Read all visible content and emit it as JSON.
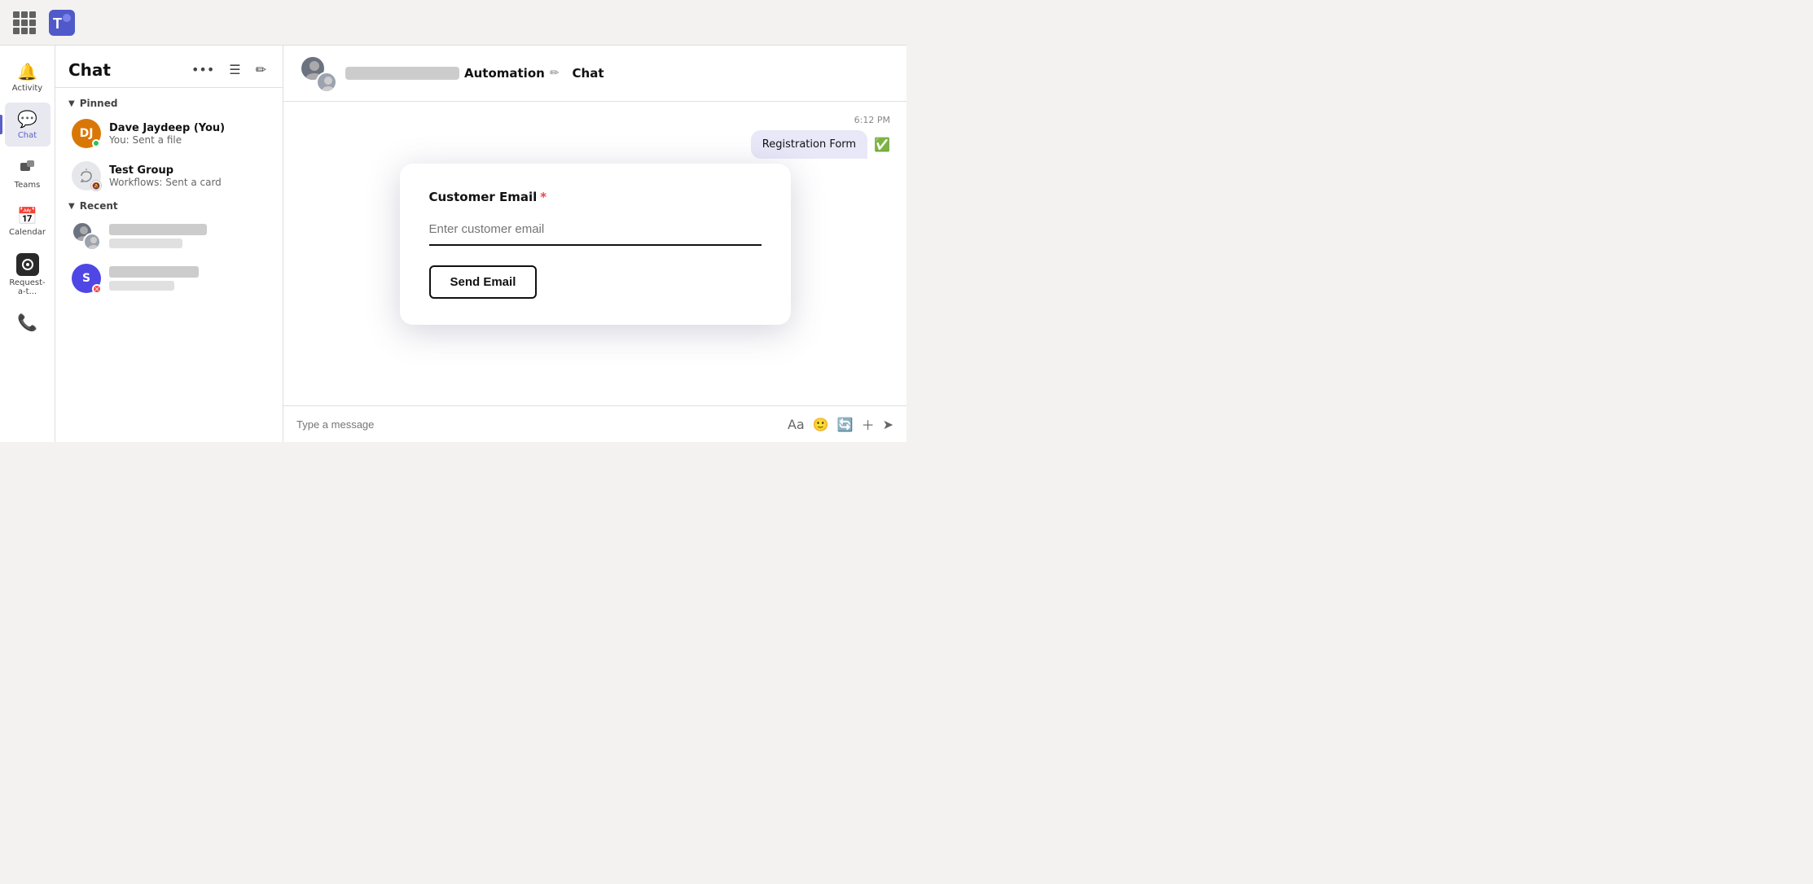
{
  "app": {
    "title": "Microsoft Teams"
  },
  "topbar": {
    "waffle_label": "Apps",
    "teams_logo": "Teams"
  },
  "sidebar": {
    "items": [
      {
        "id": "activity",
        "label": "Activity",
        "icon": "🔔",
        "active": false
      },
      {
        "id": "chat",
        "label": "Chat",
        "icon": "💬",
        "active": true
      },
      {
        "id": "teams",
        "label": "Teams",
        "icon": "🏢",
        "active": false
      },
      {
        "id": "calendar",
        "label": "Calendar",
        "icon": "📅",
        "active": false
      },
      {
        "id": "request",
        "label": "Request-a-t...",
        "icon": "⚙",
        "active": false
      }
    ]
  },
  "chat_panel": {
    "title": "Chat",
    "sections": {
      "pinned": {
        "label": "Pinned",
        "items": [
          {
            "name": "Dave Jaydeep (You)",
            "preview": "You: Sent a file",
            "avatar_initials": "DJ",
            "avatar_type": "initials",
            "status": "online"
          },
          {
            "name": "Test Group",
            "preview": "Workflows: Sent a card",
            "avatar_type": "muted",
            "status": "muted"
          }
        ]
      },
      "recent": {
        "label": "Recent",
        "items": [
          {
            "name": "Blurred Name 1",
            "preview": "",
            "avatar_type": "group",
            "blurred": true
          },
          {
            "name": "Blurred Name 2",
            "preview": "",
            "avatar_type": "s",
            "blurred": true
          }
        ]
      }
    }
  },
  "main_chat": {
    "header": {
      "name_blurred": true,
      "automation_label": "Automation",
      "tab_label": "Chat"
    },
    "messages": [
      {
        "time": "6:12 PM",
        "text": "Registration Form",
        "type": "card-bubble"
      }
    ]
  },
  "modal": {
    "field_label": "Customer Email",
    "required": true,
    "input_placeholder": "Enter customer email",
    "button_label": "Send Email"
  },
  "message_bar": {
    "placeholder": "Type a message"
  }
}
